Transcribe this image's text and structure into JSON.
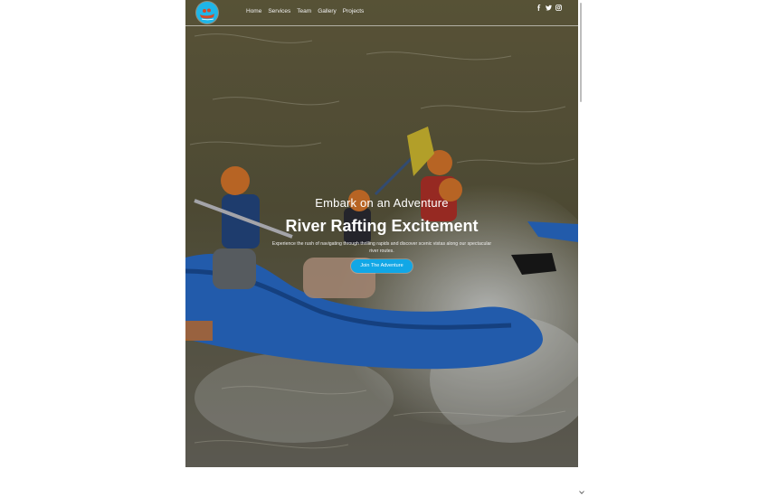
{
  "navbar": {
    "logo_icon": "raft-logo-icon",
    "links": [
      {
        "label": "Home"
      },
      {
        "label": "Services"
      },
      {
        "label": "Team"
      },
      {
        "label": "Gallery"
      },
      {
        "label": "Projects"
      }
    ],
    "social_icons": [
      "facebook-icon",
      "twitter-icon",
      "instagram-icon"
    ]
  },
  "hero": {
    "eyebrow": "Embark on an Adventure",
    "title": "River Rafting Excitement",
    "description": "Experience the rush of navigating through thrilling rapids and discover scenic vistas along our spectacular river routes.",
    "cta_label": "Join The Adventure"
  },
  "colors": {
    "accent": "#11a7e6",
    "raft_blue": "#2a6fd1",
    "helmet_orange": "#e07a2c"
  }
}
